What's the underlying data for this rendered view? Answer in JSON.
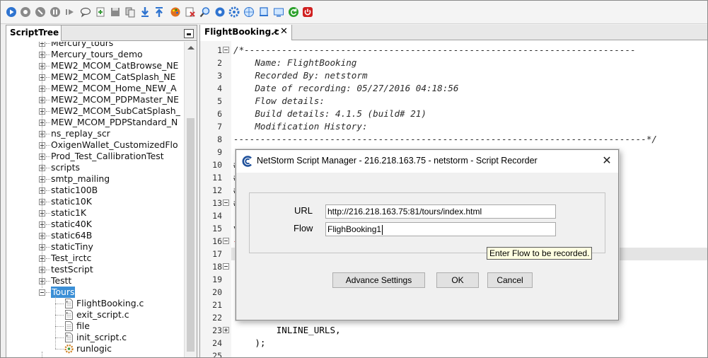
{
  "toolbar": {
    "buttons": [
      {
        "icon": "play-icon",
        "color": "#2f74d0"
      },
      {
        "icon": "record-icon",
        "color": "#8a8a8a"
      },
      {
        "icon": "stop-icon",
        "color": "#8a8a8a"
      },
      {
        "icon": "pause-icon",
        "color": "#8a8a8a"
      },
      {
        "icon": "step-icon",
        "color": "#8a8a8a"
      },
      {
        "icon": "comment-icon",
        "color": "#555555"
      },
      {
        "icon": "add-page-icon",
        "color": "#3a9a3a"
      },
      {
        "icon": "save-icon",
        "color": "#8a8a8a"
      },
      {
        "icon": "copy-icon",
        "color": "#6a6a6a"
      },
      {
        "icon": "download-icon",
        "color": "#2f74d0"
      },
      {
        "icon": "upload-icon",
        "color": "#2f74d0"
      },
      {
        "icon": "palette-icon",
        "color": "#e07020"
      },
      {
        "icon": "remove-icon",
        "color": "#d03030"
      },
      {
        "icon": "zoom-icon",
        "color": "#2f74d0"
      },
      {
        "icon": "settings-icon",
        "color": "#2f74d0"
      },
      {
        "icon": "gear-blue-icon",
        "color": "#2f74d0"
      },
      {
        "icon": "globe-icon",
        "color": "#2f74d0"
      },
      {
        "icon": "device-icon",
        "color": "#2f74d0"
      },
      {
        "icon": "screen-icon",
        "color": "#2f74d0"
      },
      {
        "icon": "refresh-icon",
        "color": "#2aa02a"
      },
      {
        "icon": "power-icon",
        "color": "#d02020"
      }
    ]
  },
  "script_tree": {
    "tab_label": "ScriptTree",
    "items": [
      {
        "label": "Mercury_tours",
        "type": "folder",
        "expanded": false
      },
      {
        "label": "Mercury_tours_demo",
        "type": "folder",
        "expanded": false
      },
      {
        "label": "MEW2_MCOM_CatBrowse_NE",
        "type": "folder",
        "expanded": false
      },
      {
        "label": "MEW2_MCOM_CatSplash_NE",
        "type": "folder",
        "expanded": false
      },
      {
        "label": "MEW2_MCOM_Home_NEW_A",
        "type": "folder",
        "expanded": false
      },
      {
        "label": "MEW2_MCOM_PDPMaster_NE",
        "type": "folder",
        "expanded": false
      },
      {
        "label": "MEW2_MCOM_SubCatSplash_",
        "type": "folder",
        "expanded": false
      },
      {
        "label": "MEW_MCOM_PDPStandard_N",
        "type": "folder",
        "expanded": false
      },
      {
        "label": "ns_replay_scr",
        "type": "folder",
        "expanded": false
      },
      {
        "label": "OxigenWallet_CustomizedFlo",
        "type": "folder",
        "expanded": false
      },
      {
        "label": "Prod_Test_CallibrationTest",
        "type": "folder",
        "expanded": false
      },
      {
        "label": "scripts",
        "type": "folder",
        "expanded": false
      },
      {
        "label": "smtp_mailing",
        "type": "folder",
        "expanded": false
      },
      {
        "label": "static100B",
        "type": "folder",
        "expanded": false
      },
      {
        "label": "static10K",
        "type": "folder",
        "expanded": false
      },
      {
        "label": "static1K",
        "type": "folder",
        "expanded": false
      },
      {
        "label": "static40K",
        "type": "folder",
        "expanded": false
      },
      {
        "label": "static64B",
        "type": "folder",
        "expanded": false
      },
      {
        "label": "staticTiny",
        "type": "folder",
        "expanded": false
      },
      {
        "label": "Test_irctc",
        "type": "folder",
        "expanded": false
      },
      {
        "label": "testScript",
        "type": "folder",
        "expanded": false
      },
      {
        "label": "Testt",
        "type": "folder",
        "expanded": false
      },
      {
        "label": "Tours",
        "type": "folder",
        "expanded": true,
        "selected": true
      },
      {
        "label": "FlightBooking.c",
        "type": "file-c"
      },
      {
        "label": "exit_script.c",
        "type": "file-c"
      },
      {
        "label": "file",
        "type": "file"
      },
      {
        "label": "init_script.c",
        "type": "file-c"
      },
      {
        "label": "runlogic",
        "type": "file-logic"
      }
    ]
  },
  "editor": {
    "tab_label": "FlightBooking.c",
    "lines": [
      {
        "n": "1",
        "text": "/*-------------------------------------------------------------------------",
        "fold": "minus",
        "style": "cmt"
      },
      {
        "n": "2",
        "text": "    Name: FlightBooking",
        "style": "cmt"
      },
      {
        "n": "3",
        "text": "    Recorded By: netstorm",
        "style": "cmt"
      },
      {
        "n": "4",
        "text": "    Date of recording: 05/27/2016 04:18:56",
        "style": "cmt"
      },
      {
        "n": "5",
        "text": "    Flow details:",
        "style": "cmt"
      },
      {
        "n": "6",
        "text": "    Build details: 4.1.5 (build# 21)",
        "style": "cmt"
      },
      {
        "n": "7",
        "text": "    Modification History:",
        "style": "cmt"
      },
      {
        "n": "8",
        "text": "-----------------------------------------------------------------------------*/",
        "style": "cmt"
      },
      {
        "n": "9",
        "text": "",
        "style": ""
      },
      {
        "n": "10",
        "text": "#",
        "style": ""
      },
      {
        "n": "11",
        "text": "#",
        "style": ""
      },
      {
        "n": "12",
        "text": "#",
        "style": ""
      },
      {
        "n": "13",
        "text": "#",
        "fold": "minus",
        "style": ""
      },
      {
        "n": "14",
        "text": "",
        "style": ""
      },
      {
        "n": "15",
        "text": "v",
        "style": ""
      },
      {
        "n": "16",
        "text": "{",
        "fold": "minus",
        "style": "str-frag"
      },
      {
        "n": "17",
        "text": "",
        "style": "",
        "highlight": true
      },
      {
        "n": "18",
        "text": "",
        "fold": "minus",
        "style": ""
      },
      {
        "n": "19",
        "text": "",
        "style": ""
      },
      {
        "n": "20",
        "text": "",
        "style": ""
      },
      {
        "n": "21",
        "text": "",
        "style": ""
      },
      {
        "n": "22",
        "text": "",
        "style": ""
      },
      {
        "n": "23",
        "text": "        INLINE_URLS,",
        "fold": "plus",
        "style": ""
      },
      {
        "n": "24",
        "text": "    );",
        "style": ""
      },
      {
        "n": "25",
        "text": "",
        "style": ""
      }
    ]
  },
  "dialog": {
    "title": "NetStorm  Script Manager - 216.218.163.75 - netstorm - Script Recorder",
    "url_label": "URL",
    "url_value": "http://216.218.163.75:81/tours/index.html",
    "flow_label": "Flow",
    "flow_value": "FlighBooking1",
    "tooltip": "Enter Flow to be recorded.",
    "advance_button": "Advance Settings",
    "ok_button": "OK",
    "cancel_button": "Cancel"
  },
  "colors": {
    "selection": "#3b8fd6",
    "tooltip_bg": "#ffffe1",
    "window_bg": "#f0f0f0"
  }
}
